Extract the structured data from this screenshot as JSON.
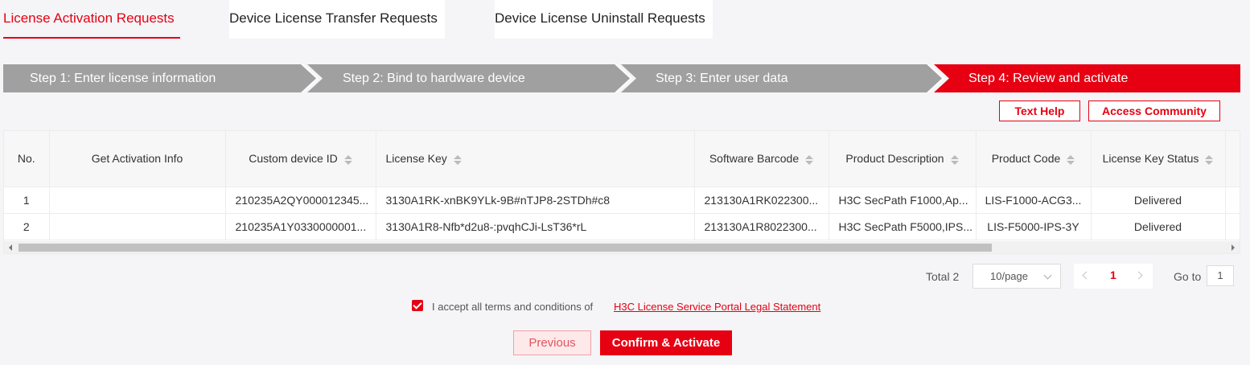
{
  "tabs": [
    {
      "label": "License Activation Requests",
      "active": true
    },
    {
      "label": "Device License Transfer Requests",
      "active": false
    },
    {
      "label": "Device License Uninstall Requests",
      "active": false
    }
  ],
  "steps": [
    {
      "label": "Step 1: Enter license information",
      "state": "done"
    },
    {
      "label": "Step 2: Bind to hardware device",
      "state": "done"
    },
    {
      "label": "Step 3: Enter user data",
      "state": "done"
    },
    {
      "label": "Step 4: Review and activate",
      "state": "current"
    }
  ],
  "help": {
    "text_help": "Text Help",
    "access_community": "Access Community"
  },
  "table": {
    "columns": [
      "No.",
      "Get Activation Info",
      "Custom device ID",
      "License Key",
      "Software Barcode",
      "Product Description",
      "Product Code",
      "License Key Status"
    ],
    "rows": [
      [
        "1",
        "",
        "210235A2QY000012345...",
        "3130A1RK-xnBK9YLk-9B#nTJP8-2STDh#c8",
        "213130A1RK022300...",
        "H3C SecPath F1000,Ap...",
        "LIS-F1000-ACG3...",
        "Delivered"
      ],
      [
        "2",
        "",
        "210235A1Y0330000001...",
        "3130A1R8-Nfb*d2u8-:pvqhCJi-LsT36*rL",
        "213130A1R8022300...",
        "H3C SecPath F5000,IPS...",
        "LIS-F5000-IPS-3Y",
        "Delivered"
      ]
    ]
  },
  "pagination": {
    "total": "Total 2",
    "page_size": "10/page",
    "current_page": "1",
    "goto_label": "Go to",
    "goto_value": "1"
  },
  "terms": {
    "text": "I accept all terms and conditions of",
    "link": "H3C License Service Portal Legal Statement"
  },
  "buttons": {
    "previous": "Previous",
    "confirm": "Confirm & Activate"
  },
  "colors": {
    "accent": "#e60012",
    "step_done": "#a0a0a0"
  }
}
